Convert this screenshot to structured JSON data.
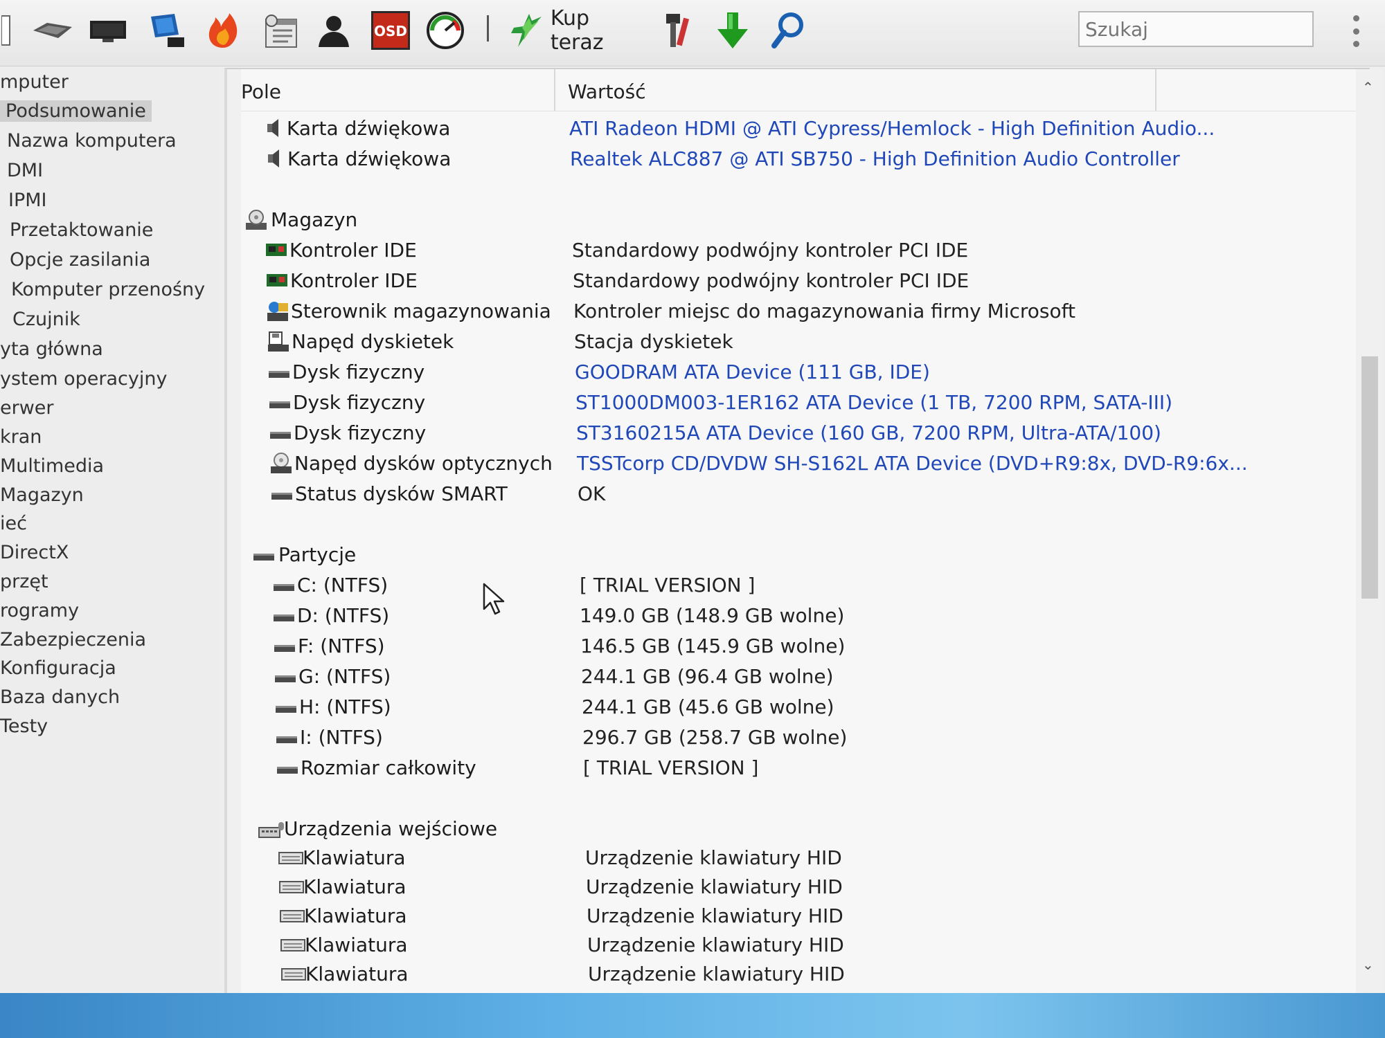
{
  "toolbar": {
    "buy_label": "Kup teraz",
    "search_placeholder": "Szukaj",
    "icons": [
      "motherboard-icon",
      "monitor-icon",
      "network-icon",
      "firefox-icon",
      "schedule-icon",
      "users-icon",
      "osd-icon",
      "benchmark-icon",
      "buy-icon",
      "tools-icon",
      "download-icon",
      "search-icon"
    ],
    "osd_text": "OSD"
  },
  "sidebar": {
    "items": [
      {
        "label": "mputer"
      },
      {
        "label": "Podsumowanie",
        "selected": true
      },
      {
        "label": "Nazwa komputera"
      },
      {
        "label": "DMI"
      },
      {
        "label": "IPMI"
      },
      {
        "label": "Przetaktowanie"
      },
      {
        "label": "Opcje zasilania"
      },
      {
        "label": "Komputer przenośny"
      },
      {
        "label": "Czujnik"
      },
      {
        "label": "yta główna"
      },
      {
        "label": "ystem operacyjny"
      },
      {
        "label": "erwer"
      },
      {
        "label": "kran"
      },
      {
        "label": "Multimedia"
      },
      {
        "label": "Magazyn"
      },
      {
        "label": "ieć"
      },
      {
        "label": "DirectX"
      },
      {
        "label": "przęt"
      },
      {
        "label": "rogramy"
      },
      {
        "label": "Zabezpieczenia"
      },
      {
        "label": "Konfiguracja"
      },
      {
        "label": "Baza danych"
      },
      {
        "label": "Testy"
      }
    ]
  },
  "table": {
    "col_field": "Pole",
    "col_value": "Wartość",
    "rows": [
      {
        "field": "Karta dźwiękowa",
        "value": "ATI Radeon HDMI @ ATI Cypress/Hemlock - High Definition Audio...",
        "link": true,
        "icon": "speaker-icon"
      },
      {
        "field": "Karta dźwiękowa",
        "value": "Realtek ALC887 @ ATI SB750 - High Definition Audio Controller",
        "link": true,
        "icon": "speaker-icon"
      },
      {
        "field": "Magazyn",
        "section": true,
        "icon": "storage-icon"
      },
      {
        "field": "Kontroler IDE",
        "value": "Standardowy podwójny kontroler PCI IDE",
        "icon": "controller-icon"
      },
      {
        "field": "Kontroler IDE",
        "value": "Standardowy podwójny kontroler PCI IDE",
        "icon": "controller-icon"
      },
      {
        "field": "Sterownik magazynowania",
        "value": "Kontroler miejsc do magazynowania firmy Microsoft",
        "icon": "storage-driver-icon"
      },
      {
        "field": "Napęd dyskietek",
        "value": "Stacja dyskietek",
        "icon": "floppy-icon"
      },
      {
        "field": "Dysk fizyczny",
        "value": "GOODRAM ATA Device  (111 GB, IDE)",
        "link": true,
        "icon": "disk-icon"
      },
      {
        "field": "Dysk fizyczny",
        "value": "ST1000DM003-1ER162 ATA Device  (1 TB, 7200 RPM, SATA-III)",
        "link": true,
        "icon": "disk-icon"
      },
      {
        "field": "Dysk fizyczny",
        "value": "ST3160215A ATA Device  (160 GB, 7200 RPM, Ultra-ATA/100)",
        "link": true,
        "icon": "disk-icon"
      },
      {
        "field": "Napęd dysków optycznych",
        "value": "TSSTcorp CD/DVDW SH-S162L ATA Device  (DVD+R9:8x, DVD-R9:6x...",
        "link": true,
        "icon": "optical-drive-icon"
      },
      {
        "field": "Status dysków SMART",
        "value": "OK",
        "icon": "disk-icon"
      },
      {
        "field": "Partycje",
        "section": true,
        "icon": "partition-icon"
      },
      {
        "field": "C: (NTFS)",
        "value": "[ TRIAL VERSION ]",
        "icon": "disk-icon"
      },
      {
        "field": "D: (NTFS)",
        "value": "149.0 GB (148.9 GB wolne)",
        "icon": "disk-icon"
      },
      {
        "field": "F: (NTFS)",
        "value": "146.5 GB (145.9 GB wolne)",
        "icon": "disk-icon"
      },
      {
        "field": "G: (NTFS)",
        "value": "244.1 GB (96.4 GB wolne)",
        "icon": "disk-icon"
      },
      {
        "field": "H: (NTFS)",
        "value": "244.1 GB (45.6 GB wolne)",
        "icon": "disk-icon"
      },
      {
        "field": "I: (NTFS)",
        "value": "296.7 GB (258.7 GB wolne)",
        "icon": "disk-icon"
      },
      {
        "field": "Rozmiar całkowity",
        "value": "[ TRIAL VERSION ]",
        "icon": "disk-icon"
      },
      {
        "field": "Urządzenia wejściowe",
        "section": true,
        "icon": "input-devices-icon"
      },
      {
        "field": "Klawiatura",
        "value": "Urządzenie klawiatury HID",
        "icon": "keyboard-icon"
      },
      {
        "field": "Klawiatura",
        "value": "Urządzenie klawiatury HID",
        "icon": "keyboard-icon"
      },
      {
        "field": "Klawiatura",
        "value": "Urządzenie klawiatury HID",
        "icon": "keyboard-icon"
      },
      {
        "field": "Klawiatura",
        "value": "Urządzenie klawiatury HID",
        "icon": "keyboard-icon"
      },
      {
        "field": "Klawiatura",
        "value": "Urządzenie klawiatury HID",
        "icon": "keyboard-icon"
      }
    ]
  },
  "colors": {
    "link": "#1f47b8",
    "selection": "#cfcfcf",
    "taskbar": "#4a98d2"
  }
}
